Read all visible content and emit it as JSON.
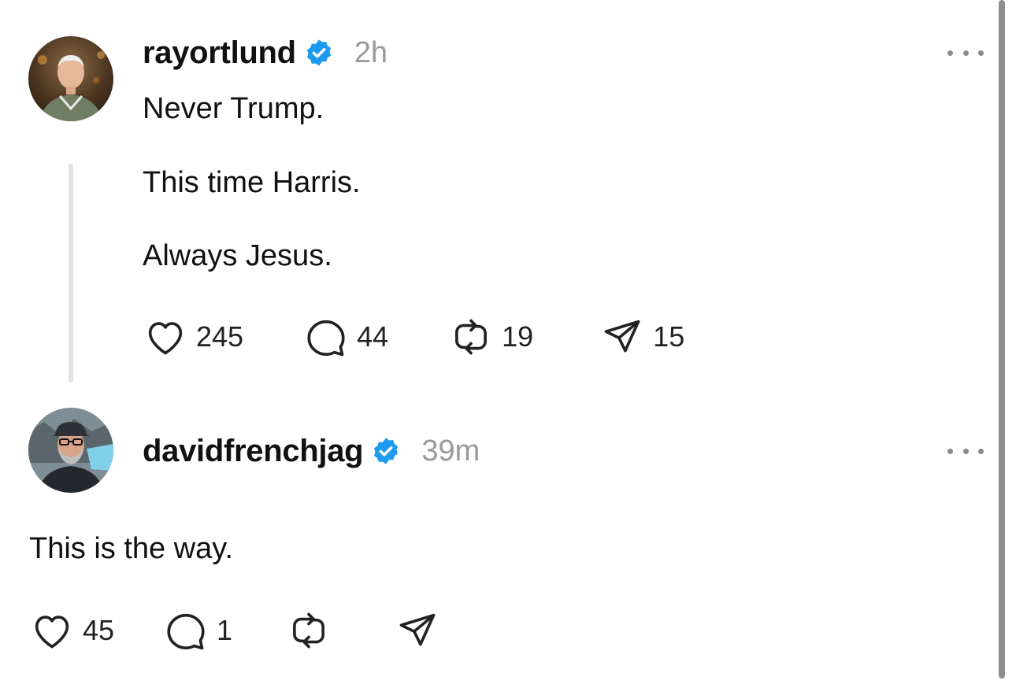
{
  "colors": {
    "verified_badge": "#1d9bf0",
    "text_primary": "#111111",
    "text_secondary": "#9a9a9a",
    "thread_line": "#e2e2e2"
  },
  "posts": [
    {
      "username": "rayortlund",
      "verified": true,
      "timestamp": "2h",
      "lines": [
        "Never Trump.",
        "This time Harris.",
        "Always Jesus."
      ],
      "stats": {
        "likes": "245",
        "replies": "44",
        "reposts": "19",
        "shares": "15"
      }
    },
    {
      "username": "davidfrenchjag",
      "verified": true,
      "timestamp": "39m",
      "lines": [
        "This is the way."
      ],
      "stats": {
        "likes": "45",
        "replies": "1"
      }
    }
  ],
  "icons": {
    "like": "heart-icon",
    "reply": "speech-bubble-icon",
    "repost": "repost-arrows-icon",
    "share": "paper-plane-icon",
    "more": "more-dots-icon",
    "verified": "verified-badge-icon"
  }
}
